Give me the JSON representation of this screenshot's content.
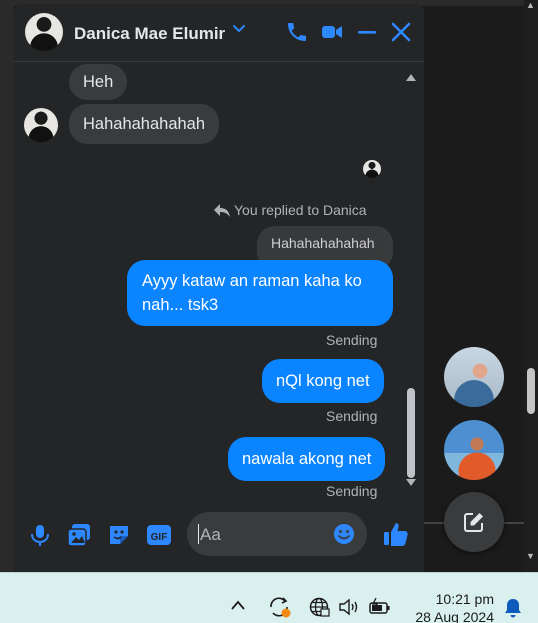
{
  "header": {
    "contact_name": "Danica Mae Elumir"
  },
  "messages": [
    {
      "side": "in",
      "text": "Heh"
    },
    {
      "side": "in",
      "text": "Hahahahahahah"
    },
    {
      "side": "out",
      "text_line1": "Ayyy kataw an raman kaha ko",
      "text_line2": "nah... tsk3",
      "status": "Sending"
    },
    {
      "side": "out",
      "text": "nQl kong net",
      "status": "Sending"
    },
    {
      "side": "out",
      "text": "nawala akong net",
      "status": "Sending"
    }
  ],
  "reply": {
    "note": "You replied to Danica",
    "quoted_text": "Hahahahahahah"
  },
  "composer": {
    "placeholder": "Aa"
  },
  "taskbar": {
    "time": "10:21 pm",
    "date": "28 Aug 2024"
  },
  "colors": {
    "outgoing_bubble": "#0a84ff",
    "incoming_bubble": "#3a3b3c",
    "panel_bg": "#242526",
    "accent_icons": "#2d88ff",
    "taskbar_bg": "#d9f0ee"
  },
  "icons": {
    "header": [
      "chevron-down-icon",
      "phone-icon",
      "video-icon",
      "minimize-icon",
      "close-icon"
    ],
    "composer": [
      "microphone-icon",
      "photo-icon",
      "sticker-icon",
      "gif-icon",
      "emoji-icon",
      "thumbs-up-icon"
    ],
    "taskbar": [
      "chevron-up-icon",
      "sync-icon",
      "globe-icon",
      "volume-icon",
      "battery-icon",
      "notification-bell-icon"
    ]
  }
}
